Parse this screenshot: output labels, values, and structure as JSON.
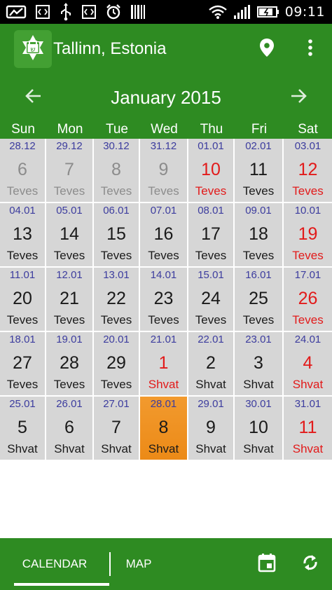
{
  "status_bar": {
    "time": "09:11",
    "icons": [
      "picture-icon",
      "code-icon",
      "usb-icon",
      "code-icon",
      "alarm-icon",
      "barcode-icon",
      "wifi-icon",
      "signal-icon",
      "battery-icon"
    ]
  },
  "app_bar": {
    "location": "Tallinn, Estonia",
    "logo_letter": "ש",
    "colors": {
      "primary": "#2e8b22",
      "cell": "#d6d6d6",
      "today": "#f0921f",
      "holiday": "#e21a1a",
      "gregorian": "#3c3c9e"
    }
  },
  "calendar": {
    "month_title": "January 2015",
    "weekdays": [
      "Sun",
      "Mon",
      "Tue",
      "Wed",
      "Thu",
      "Fri",
      "Sat"
    ],
    "weeks": [
      [
        {
          "greg": "28.12",
          "day": "6",
          "month": "Teves",
          "style": "faded"
        },
        {
          "greg": "29.12",
          "day": "7",
          "month": "Teves",
          "style": "faded"
        },
        {
          "greg": "30.12",
          "day": "8",
          "month": "Teves",
          "style": "faded"
        },
        {
          "greg": "31.12",
          "day": "9",
          "month": "Teves",
          "style": "faded"
        },
        {
          "greg": "01.01",
          "day": "10",
          "month": "Teves",
          "style": "red"
        },
        {
          "greg": "02.01",
          "day": "11",
          "month": "Teves",
          "style": "normal"
        },
        {
          "greg": "03.01",
          "day": "12",
          "month": "Teves",
          "style": "red"
        }
      ],
      [
        {
          "greg": "04.01",
          "day": "13",
          "month": "Teves",
          "style": "normal"
        },
        {
          "greg": "05.01",
          "day": "14",
          "month": "Teves",
          "style": "normal"
        },
        {
          "greg": "06.01",
          "day": "15",
          "month": "Teves",
          "style": "normal"
        },
        {
          "greg": "07.01",
          "day": "16",
          "month": "Teves",
          "style": "normal"
        },
        {
          "greg": "08.01",
          "day": "17",
          "month": "Teves",
          "style": "normal"
        },
        {
          "greg": "09.01",
          "day": "18",
          "month": "Teves",
          "style": "normal"
        },
        {
          "greg": "10.01",
          "day": "19",
          "month": "Teves",
          "style": "red"
        }
      ],
      [
        {
          "greg": "11.01",
          "day": "20",
          "month": "Teves",
          "style": "normal"
        },
        {
          "greg": "12.01",
          "day": "21",
          "month": "Teves",
          "style": "normal"
        },
        {
          "greg": "13.01",
          "day": "22",
          "month": "Teves",
          "style": "normal"
        },
        {
          "greg": "14.01",
          "day": "23",
          "month": "Teves",
          "style": "normal"
        },
        {
          "greg": "15.01",
          "day": "24",
          "month": "Teves",
          "style": "normal"
        },
        {
          "greg": "16.01",
          "day": "25",
          "month": "Teves",
          "style": "normal"
        },
        {
          "greg": "17.01",
          "day": "26",
          "month": "Teves",
          "style": "red"
        }
      ],
      [
        {
          "greg": "18.01",
          "day": "27",
          "month": "Teves",
          "style": "normal"
        },
        {
          "greg": "19.01",
          "day": "28",
          "month": "Teves",
          "style": "normal"
        },
        {
          "greg": "20.01",
          "day": "29",
          "month": "Teves",
          "style": "normal"
        },
        {
          "greg": "21.01",
          "day": "1",
          "month": "Shvat",
          "style": "red"
        },
        {
          "greg": "22.01",
          "day": "2",
          "month": "Shvat",
          "style": "normal"
        },
        {
          "greg": "23.01",
          "day": "3",
          "month": "Shvat",
          "style": "normal"
        },
        {
          "greg": "24.01",
          "day": "4",
          "month": "Shvat",
          "style": "red"
        }
      ],
      [
        {
          "greg": "25.01",
          "day": "5",
          "month": "Shvat",
          "style": "normal"
        },
        {
          "greg": "26.01",
          "day": "6",
          "month": "Shvat",
          "style": "normal"
        },
        {
          "greg": "27.01",
          "day": "7",
          "month": "Shvat",
          "style": "normal"
        },
        {
          "greg": "28.01",
          "day": "8",
          "month": "Shvat",
          "style": "today"
        },
        {
          "greg": "29.01",
          "day": "9",
          "month": "Shvat",
          "style": "normal"
        },
        {
          "greg": "30.01",
          "day": "10",
          "month": "Shvat",
          "style": "normal"
        },
        {
          "greg": "31.01",
          "day": "11",
          "month": "Shvat",
          "style": "red"
        }
      ]
    ]
  },
  "bottom_bar": {
    "tabs": [
      "CALENDAR",
      "MAP"
    ],
    "active_tab": "CALENDAR",
    "actions": [
      "calendar-today-icon",
      "sync-icon"
    ]
  }
}
